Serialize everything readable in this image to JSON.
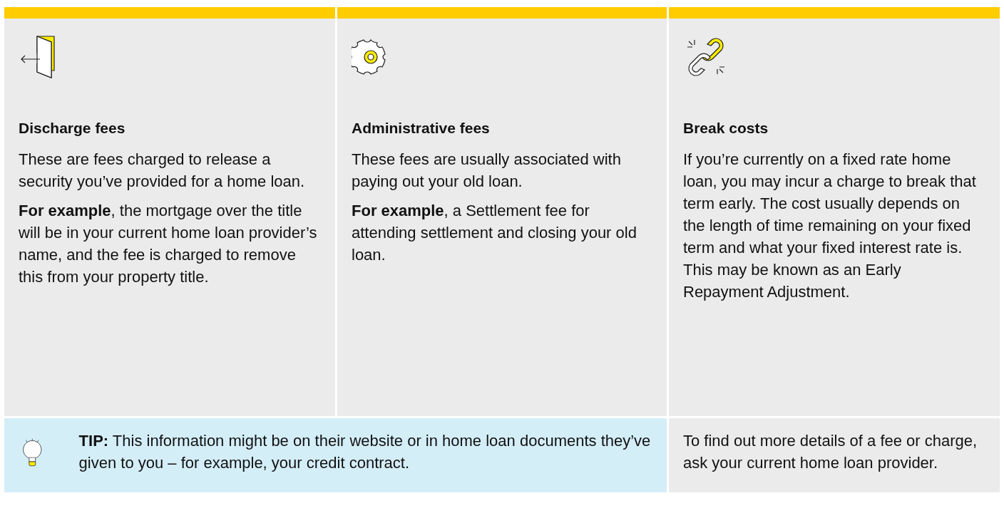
{
  "fee_columns": [
    {
      "heading": "Discharge fees",
      "paragraphs": [
        "These are fees charged to release a security you’ve provided for a home loan.",
        "**For example**, the mortgage over the title will be in your current home loan provider’s name, and the fee is charged to remove this from your property title."
      ]
    },
    {
      "heading": "Administrative fees",
      "paragraphs": [
        "These fees are usually associated with paying out your old loan.",
        "**For example**, a Settlement fee for attending settlement and closing your old loan."
      ]
    },
    {
      "heading": "Break costs",
      "paragraphs": [
        "If you’re currently on a fixed rate home loan, you may incur a charge to break that term early. The cost usually depends on the length of time remaining on your fixed term and what your fixed interest rate is. This may be known as an Early Repayment Adjustment."
      ]
    }
  ],
  "tip": {
    "text": "**TIP:** This information might be on their website or in home loan documents they’ve given to you – for example, your credit contract."
  },
  "note": "To find out more details of a fee or charge, ask your current home loan provider."
}
